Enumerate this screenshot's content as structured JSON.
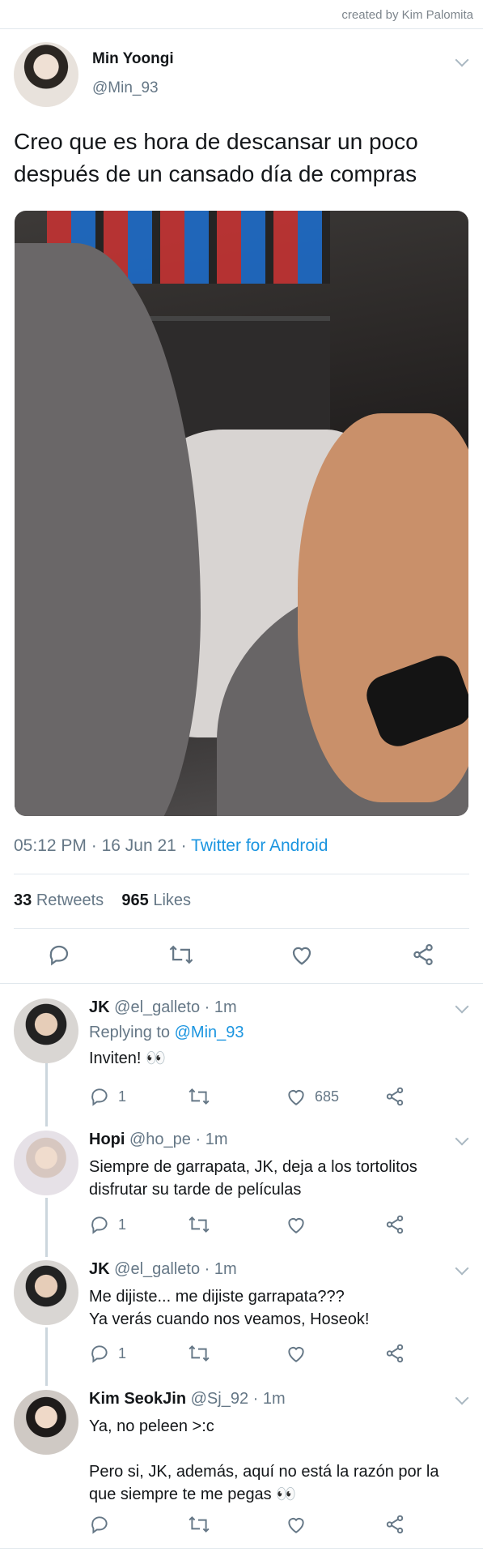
{
  "watermark": "created by Kim Palomita",
  "tweet": {
    "name": "Min Yoongi",
    "handle": "@Min_93",
    "text": "Creo que es hora de descansar un poco después de un cansado día de compras",
    "time": "05:12 PM",
    "date": "16 Jun 21",
    "source": "Twitter for Android",
    "retweets_count": "33",
    "retweets_label": "Retweets",
    "likes_count": "965",
    "likes_label": "Likes"
  },
  "replies": [
    {
      "name": "JK",
      "handle": "@el_galleto",
      "time": "1m",
      "replying_label": "Replying to",
      "replying_handle": "@Min_93",
      "text": "Inviten! 👀",
      "reply_count": "1",
      "like_count": "685"
    },
    {
      "name": "Hopi",
      "handle": "@ho_pe",
      "time": "1m",
      "text": "Siempre de garrapata, JK, deja a los tortolitos disfrutar su tarde de películas",
      "reply_count": "1"
    },
    {
      "name": "JK",
      "handle": "@el_galleto",
      "time": "1m",
      "text_line1": "Me dijiste... me dijiste garrapata???",
      "text_line2": "Ya verás cuando nos veamos, Hoseok!",
      "reply_count": "1"
    },
    {
      "name": "Kim SeokJin",
      "handle": "@Sj_92",
      "time": "1m",
      "text_line1": "Ya, no peleen >:c",
      "text_line2": "Pero si, JK, además, aquí no está la razón por la que siempre te me pegas 👀"
    }
  ],
  "separator": "·",
  "colors": {
    "accent": "#1b95e0",
    "muted": "#657786",
    "divider": "#e1e8ed"
  },
  "icons": [
    "reply-icon",
    "retweet-icon",
    "like-icon",
    "share-icon",
    "chevron-down-icon"
  ]
}
